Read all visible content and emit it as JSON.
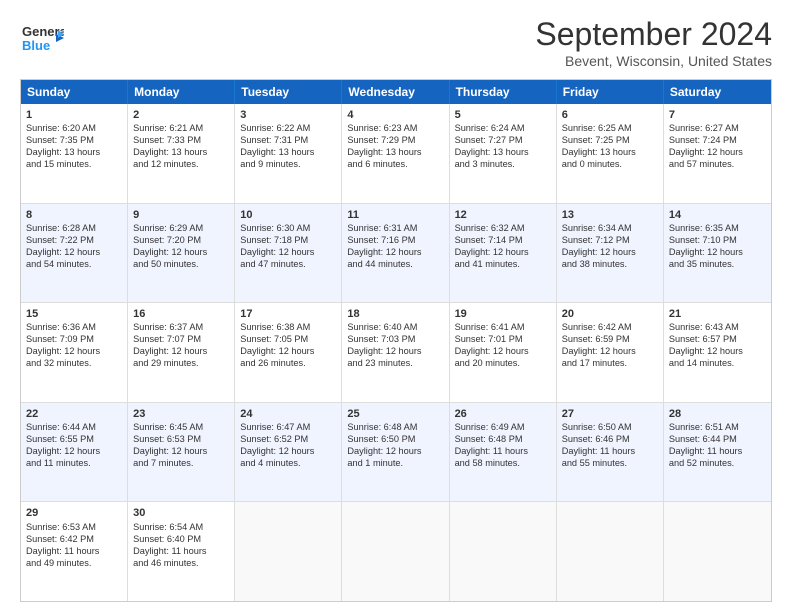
{
  "logo": {
    "line1": "General",
    "line2": "Blue",
    "icon": "▶"
  },
  "title": "September 2024",
  "subtitle": "Bevent, Wisconsin, United States",
  "header_days": [
    "Sunday",
    "Monday",
    "Tuesday",
    "Wednesday",
    "Thursday",
    "Friday",
    "Saturday"
  ],
  "rows": [
    [
      {
        "day": "1",
        "lines": [
          "Sunrise: 6:20 AM",
          "Sunset: 7:35 PM",
          "Daylight: 13 hours",
          "and 15 minutes."
        ]
      },
      {
        "day": "2",
        "lines": [
          "Sunrise: 6:21 AM",
          "Sunset: 7:33 PM",
          "Daylight: 13 hours",
          "and 12 minutes."
        ]
      },
      {
        "day": "3",
        "lines": [
          "Sunrise: 6:22 AM",
          "Sunset: 7:31 PM",
          "Daylight: 13 hours",
          "and 9 minutes."
        ]
      },
      {
        "day": "4",
        "lines": [
          "Sunrise: 6:23 AM",
          "Sunset: 7:29 PM",
          "Daylight: 13 hours",
          "and 6 minutes."
        ]
      },
      {
        "day": "5",
        "lines": [
          "Sunrise: 6:24 AM",
          "Sunset: 7:27 PM",
          "Daylight: 13 hours",
          "and 3 minutes."
        ]
      },
      {
        "day": "6",
        "lines": [
          "Sunrise: 6:25 AM",
          "Sunset: 7:25 PM",
          "Daylight: 13 hours",
          "and 0 minutes."
        ]
      },
      {
        "day": "7",
        "lines": [
          "Sunrise: 6:27 AM",
          "Sunset: 7:24 PM",
          "Daylight: 12 hours",
          "and 57 minutes."
        ]
      }
    ],
    [
      {
        "day": "8",
        "lines": [
          "Sunrise: 6:28 AM",
          "Sunset: 7:22 PM",
          "Daylight: 12 hours",
          "and 54 minutes."
        ]
      },
      {
        "day": "9",
        "lines": [
          "Sunrise: 6:29 AM",
          "Sunset: 7:20 PM",
          "Daylight: 12 hours",
          "and 50 minutes."
        ]
      },
      {
        "day": "10",
        "lines": [
          "Sunrise: 6:30 AM",
          "Sunset: 7:18 PM",
          "Daylight: 12 hours",
          "and 47 minutes."
        ]
      },
      {
        "day": "11",
        "lines": [
          "Sunrise: 6:31 AM",
          "Sunset: 7:16 PM",
          "Daylight: 12 hours",
          "and 44 minutes."
        ]
      },
      {
        "day": "12",
        "lines": [
          "Sunrise: 6:32 AM",
          "Sunset: 7:14 PM",
          "Daylight: 12 hours",
          "and 41 minutes."
        ]
      },
      {
        "day": "13",
        "lines": [
          "Sunrise: 6:34 AM",
          "Sunset: 7:12 PM",
          "Daylight: 12 hours",
          "and 38 minutes."
        ]
      },
      {
        "day": "14",
        "lines": [
          "Sunrise: 6:35 AM",
          "Sunset: 7:10 PM",
          "Daylight: 12 hours",
          "and 35 minutes."
        ]
      }
    ],
    [
      {
        "day": "15",
        "lines": [
          "Sunrise: 6:36 AM",
          "Sunset: 7:09 PM",
          "Daylight: 12 hours",
          "and 32 minutes."
        ]
      },
      {
        "day": "16",
        "lines": [
          "Sunrise: 6:37 AM",
          "Sunset: 7:07 PM",
          "Daylight: 12 hours",
          "and 29 minutes."
        ]
      },
      {
        "day": "17",
        "lines": [
          "Sunrise: 6:38 AM",
          "Sunset: 7:05 PM",
          "Daylight: 12 hours",
          "and 26 minutes."
        ]
      },
      {
        "day": "18",
        "lines": [
          "Sunrise: 6:40 AM",
          "Sunset: 7:03 PM",
          "Daylight: 12 hours",
          "and 23 minutes."
        ]
      },
      {
        "day": "19",
        "lines": [
          "Sunrise: 6:41 AM",
          "Sunset: 7:01 PM",
          "Daylight: 12 hours",
          "and 20 minutes."
        ]
      },
      {
        "day": "20",
        "lines": [
          "Sunrise: 6:42 AM",
          "Sunset: 6:59 PM",
          "Daylight: 12 hours",
          "and 17 minutes."
        ]
      },
      {
        "day": "21",
        "lines": [
          "Sunrise: 6:43 AM",
          "Sunset: 6:57 PM",
          "Daylight: 12 hours",
          "and 14 minutes."
        ]
      }
    ],
    [
      {
        "day": "22",
        "lines": [
          "Sunrise: 6:44 AM",
          "Sunset: 6:55 PM",
          "Daylight: 12 hours",
          "and 11 minutes."
        ]
      },
      {
        "day": "23",
        "lines": [
          "Sunrise: 6:45 AM",
          "Sunset: 6:53 PM",
          "Daylight: 12 hours",
          "and 7 minutes."
        ]
      },
      {
        "day": "24",
        "lines": [
          "Sunrise: 6:47 AM",
          "Sunset: 6:52 PM",
          "Daylight: 12 hours",
          "and 4 minutes."
        ]
      },
      {
        "day": "25",
        "lines": [
          "Sunrise: 6:48 AM",
          "Sunset: 6:50 PM",
          "Daylight: 12 hours",
          "and 1 minute."
        ]
      },
      {
        "day": "26",
        "lines": [
          "Sunrise: 6:49 AM",
          "Sunset: 6:48 PM",
          "Daylight: 11 hours",
          "and 58 minutes."
        ]
      },
      {
        "day": "27",
        "lines": [
          "Sunrise: 6:50 AM",
          "Sunset: 6:46 PM",
          "Daylight: 11 hours",
          "and 55 minutes."
        ]
      },
      {
        "day": "28",
        "lines": [
          "Sunrise: 6:51 AM",
          "Sunset: 6:44 PM",
          "Daylight: 11 hours",
          "and 52 minutes."
        ]
      }
    ],
    [
      {
        "day": "29",
        "lines": [
          "Sunrise: 6:53 AM",
          "Sunset: 6:42 PM",
          "Daylight: 11 hours",
          "and 49 minutes."
        ]
      },
      {
        "day": "30",
        "lines": [
          "Sunrise: 6:54 AM",
          "Sunset: 6:40 PM",
          "Daylight: 11 hours",
          "and 46 minutes."
        ]
      },
      {
        "day": "",
        "lines": []
      },
      {
        "day": "",
        "lines": []
      },
      {
        "day": "",
        "lines": []
      },
      {
        "day": "",
        "lines": []
      },
      {
        "day": "",
        "lines": []
      }
    ]
  ]
}
